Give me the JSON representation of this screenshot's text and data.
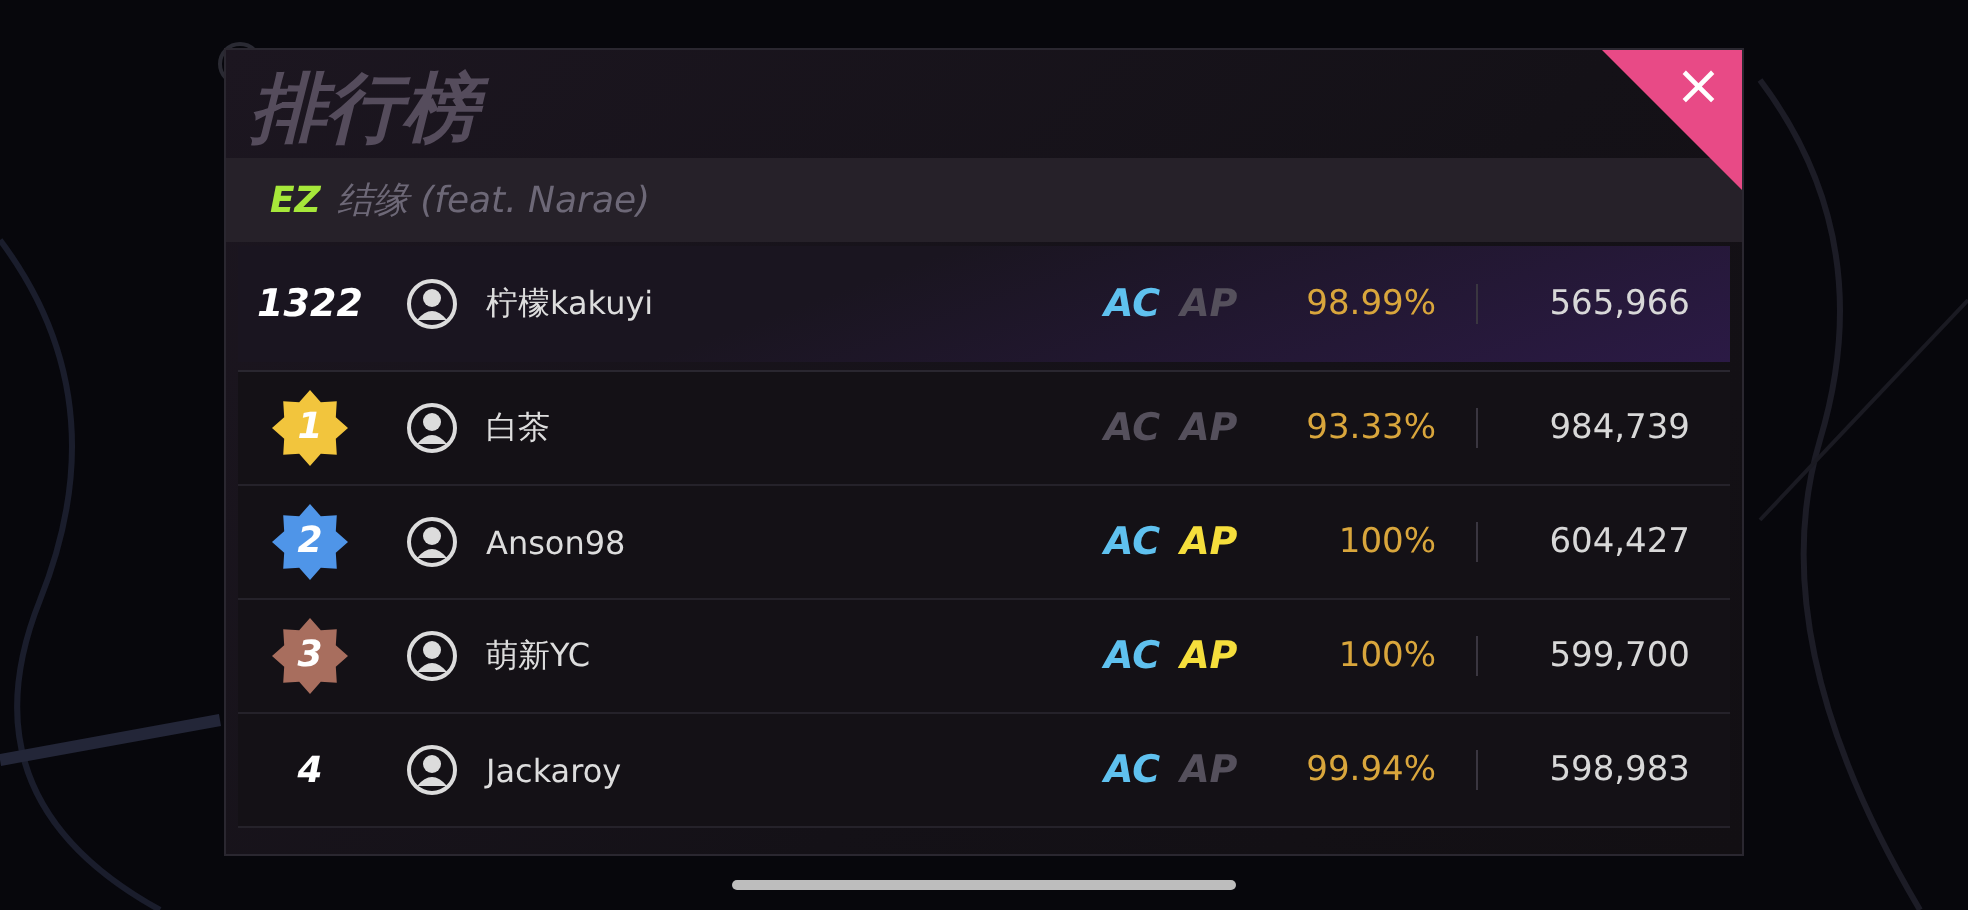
{
  "title": "排行榜",
  "song": {
    "difficulty": "EZ",
    "name": "结缘 (feat. Narae)"
  },
  "close": {
    "label": "×"
  },
  "my_entry": {
    "rank": "1322",
    "name": "柠檬kakuyi",
    "badges": [
      {
        "label": "AC",
        "achieved": true
      },
      {
        "label": "AP",
        "achieved": false
      }
    ],
    "accuracy": "98.99%",
    "score": "565,966"
  },
  "entries": [
    {
      "kind": "medal",
      "color": "#f2c53d",
      "rank": "1",
      "name": "白茶",
      "badges": [
        {
          "label": "AC",
          "achieved": false
        },
        {
          "label": "AP",
          "achieved": false
        }
      ],
      "accuracy": "93.33%",
      "score": "984,739"
    },
    {
      "kind": "medal",
      "color": "#4f95e8",
      "rank": "2",
      "name": "Anson98",
      "badges": [
        {
          "label": "AC",
          "achieved": true
        },
        {
          "label": "AP",
          "achieved": true
        }
      ],
      "accuracy": "100%",
      "score": "604,427"
    },
    {
      "kind": "medal",
      "color": "#a86e5e",
      "rank": "3",
      "name": "萌新YC",
      "badges": [
        {
          "label": "AC",
          "achieved": true
        },
        {
          "label": "AP",
          "achieved": true
        }
      ],
      "accuracy": "100%",
      "score": "599,700"
    },
    {
      "kind": "plain",
      "rank": "4",
      "name": "Jackaroy",
      "badges": [
        {
          "label": "AC",
          "achieved": true
        },
        {
          "label": "AP",
          "achieved": false
        }
      ],
      "accuracy": "99.94%",
      "score": "598,983"
    }
  ]
}
